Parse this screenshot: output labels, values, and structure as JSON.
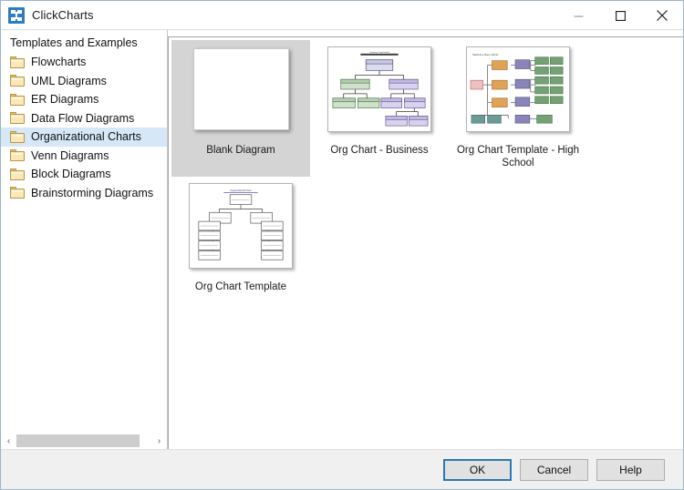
{
  "window": {
    "title": "ClickCharts",
    "app_icon": "clickcharts-app-icon",
    "controls": {
      "minimize": "minimize-icon",
      "maximize": "maximize-icon",
      "close": "close-icon"
    }
  },
  "sidebar": {
    "header": "Templates and Examples",
    "items": [
      {
        "label": "Flowcharts",
        "icon": "folder-icon",
        "selected": false
      },
      {
        "label": "UML Diagrams",
        "icon": "folder-icon",
        "selected": false
      },
      {
        "label": "ER Diagrams",
        "icon": "folder-icon",
        "selected": false
      },
      {
        "label": "Data Flow Diagrams",
        "icon": "folder-icon",
        "selected": false
      },
      {
        "label": "Organizational Charts",
        "icon": "folder-icon",
        "selected": true
      },
      {
        "label": "Venn Diagrams",
        "icon": "folder-icon",
        "selected": false
      },
      {
        "label": "Block Diagrams",
        "icon": "folder-icon",
        "selected": false
      },
      {
        "label": "Brainstorming Diagrams",
        "icon": "folder-icon",
        "selected": false
      }
    ],
    "scrollbar": {
      "left_arrow": "‹",
      "right_arrow": "›"
    }
  },
  "templates": [
    {
      "label": "Blank Diagram",
      "thumb": "blank",
      "selected": true
    },
    {
      "label": "Org Chart - Business",
      "thumb": "business",
      "selected": false
    },
    {
      "label": "Org Chart Template - High School",
      "thumb": "highschool",
      "selected": false
    },
    {
      "label": "Org Chart Template",
      "thumb": "plain",
      "selected": false
    }
  ],
  "footer": {
    "ok_label": "OK",
    "cancel_label": "Cancel",
    "help_label": "Help"
  },
  "colors": {
    "selection_blue": "#d6e8f7",
    "selection_gray": "#d4d4d4",
    "default_button_border": "#2a7ab0",
    "titlebar": "#ffffff",
    "footer": "#f0f0f0"
  }
}
